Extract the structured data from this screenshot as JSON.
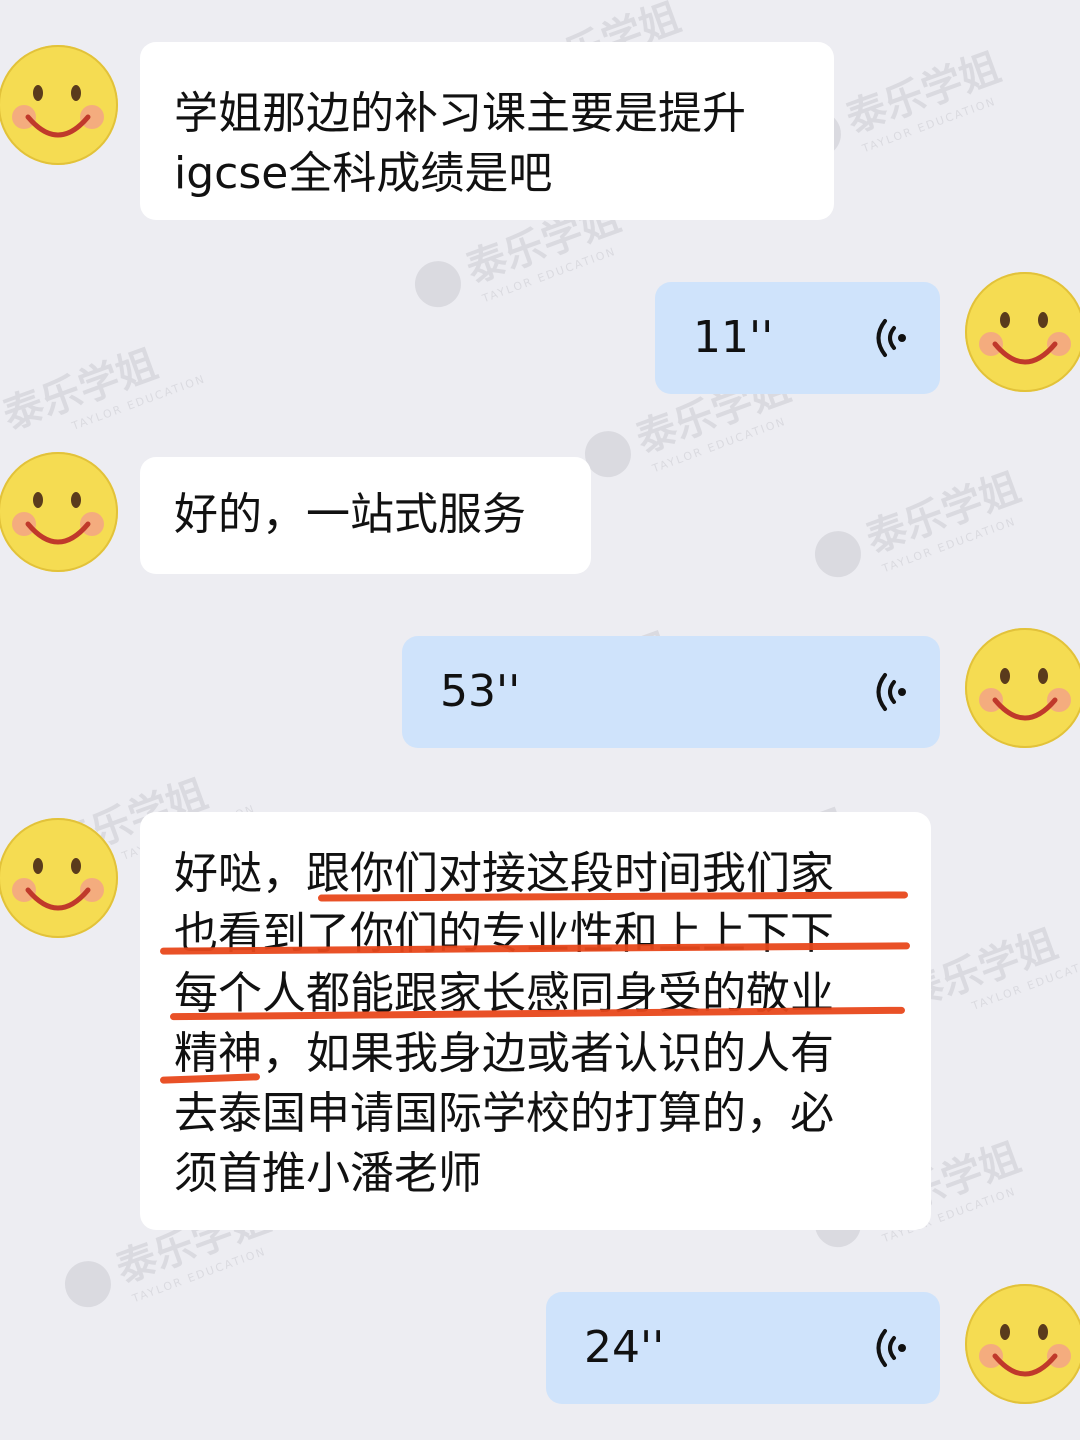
{
  "chat": {
    "messages": [
      {
        "type": "text",
        "side": "left",
        "text": "学姐那边的补习课主要是提升\nigcse全科成绩是吧"
      },
      {
        "type": "voice",
        "side": "right",
        "duration": "11''"
      },
      {
        "type": "text",
        "side": "left",
        "text": "好的，一站式服务"
      },
      {
        "type": "voice",
        "side": "right",
        "duration": "53''"
      },
      {
        "type": "text",
        "side": "left",
        "text": "好哒，跟你们对接这段时间我们家\n也看到了你们的专业性和上上下下\n每个人都能跟家长感同身受的敬业\n精神，如果我身边或者认识的人有\n去泰国申请国际学校的打算的，必\n须首推小潘老师"
      },
      {
        "type": "voice",
        "side": "right",
        "duration": "24''"
      }
    ]
  },
  "watermark": {
    "brand": "泰乐学姐",
    "sub": "TAYLOR EDUCATION"
  },
  "avatar_icon": "smiley-face-icon",
  "voice_icon": "voice-wave-icon",
  "colors": {
    "background": "#ededf2",
    "sent_bubble": "#cfe3fb",
    "recv_bubble": "#ffffff",
    "underline": "#e8481b"
  }
}
